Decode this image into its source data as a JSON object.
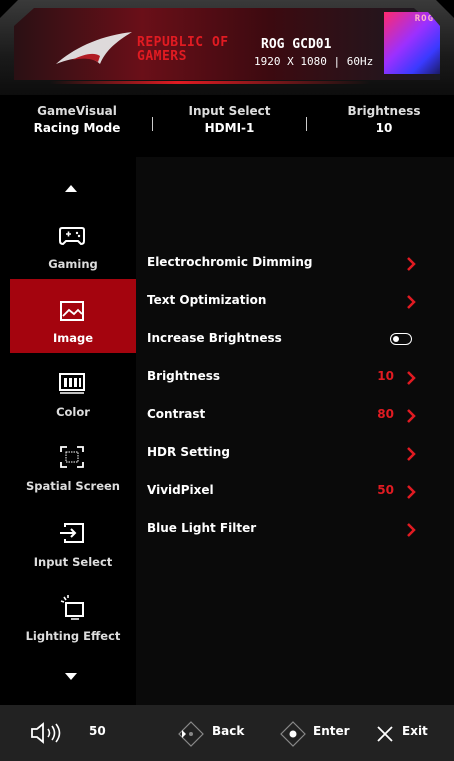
{
  "header": {
    "brand_line1": "REPUBLIC OF",
    "brand_line2": "GAMERS",
    "model": "ROG GCD01",
    "resolution": "1920 X 1080 | 60Hz",
    "badge_text": "ROG",
    "accent_color": "#e11b22"
  },
  "status": {
    "gamevisual": {
      "label": "GameVisual",
      "value": "Racing Mode"
    },
    "input": {
      "label": "Input Select",
      "value": "HDMI-1"
    },
    "brightness": {
      "label": "Brightness",
      "value": "10"
    }
  },
  "sidebar": {
    "items": [
      {
        "label": "Gaming",
        "icon": "gamepad-icon"
      },
      {
        "label": "Image",
        "icon": "image-icon",
        "active": true
      },
      {
        "label": "Color",
        "icon": "color-bars-icon"
      },
      {
        "label": "Spatial Screen",
        "icon": "spatial-screen-icon"
      },
      {
        "label": "Input Select",
        "icon": "input-arrow-icon"
      },
      {
        "label": "Lighting Effect",
        "icon": "lighting-icon"
      }
    ],
    "active_color": "#a4040e"
  },
  "menu": {
    "items": [
      {
        "label": "Electrochromic Dimming",
        "value": "",
        "control": "chevron"
      },
      {
        "label": "Text Optimization",
        "value": "",
        "control": "chevron"
      },
      {
        "label": "Increase Brightness",
        "value": "",
        "control": "toggle"
      },
      {
        "label": "Brightness",
        "value": "10",
        "control": "chevron"
      },
      {
        "label": "Contrast",
        "value": "80",
        "control": "chevron"
      },
      {
        "label": "HDR Setting",
        "value": "",
        "control": "chevron"
      },
      {
        "label": "VividPixel",
        "value": "50",
        "control": "chevron"
      },
      {
        "label": "Blue Light Filter",
        "value": "",
        "control": "chevron"
      }
    ]
  },
  "footer": {
    "volume": "50",
    "back": "Back",
    "enter": "Enter",
    "exit": "Exit"
  }
}
